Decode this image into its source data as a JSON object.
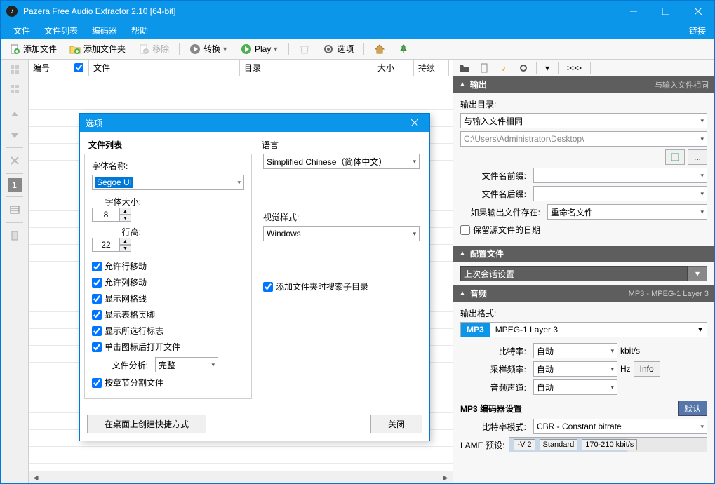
{
  "title_bar": {
    "title": "Pazera Free Audio Extractor 2.10  [64-bit]"
  },
  "menu": {
    "file": "文件",
    "filelist": "文件列表",
    "encoder": "编码器",
    "help": "帮助",
    "link": "链接"
  },
  "toolbar": {
    "add_file": "添加文件",
    "add_folder": "添加文件夹",
    "remove": "移除",
    "convert": "转换",
    "play": "Play",
    "options": "选项"
  },
  "columns": {
    "num": "编号",
    "file": "文件",
    "dir": "目录",
    "size": "大小",
    "dur": "持续"
  },
  "right": {
    "output_header": "输出",
    "output_sub": "与输入文件相同",
    "output_dir_label": "输出目录:",
    "output_dir_same": "与输入文件相同",
    "output_path": "C:\\Users\\Administrator\\Desktop\\",
    "prefix_label": "文件名前缀:",
    "suffix_label": "文件名后缀:",
    "exists_label": "如果输出文件存在:",
    "exists_value": "重命名文件",
    "preserve_date": "保留源文件的日期",
    "config_header": "配置文件",
    "config_value": "上次会话设置",
    "audio_header": "音频",
    "audio_sub": "MP3 - MPEG-1 Layer 3",
    "output_format_label": "输出格式:",
    "format_code": "MP3",
    "format_name": "MPEG-1 Layer 3",
    "bitrate_label": "比特率:",
    "bitrate_value": "自动",
    "bitrate_unit": "kbit/s",
    "samplerate_label": "采样频率:",
    "samplerate_value": "自动",
    "samplerate_unit": "Hz",
    "info_btn": "Info",
    "channels_label": "音频声道:",
    "channels_value": "自动",
    "mp3_encoder_label": "MP3 编码器设置",
    "bitrate_mode_label": "比特率模式:",
    "bitrate_mode_value": "CBR - Constant bitrate",
    "lame_label": "LAME 预设:",
    "lame_v": "-V 2",
    "lame_std": "Standard",
    "lame_range": "170-210 kbit/s",
    "default_btn": "默认"
  },
  "right_tabs_more": ">>>",
  "dialog": {
    "title": "选项",
    "filelist_header": "文件列表",
    "fontname_label": "字体名称:",
    "fontname_value": "Segoe UI",
    "fontsize_label": "字体大小:",
    "fontsize_value": "8",
    "rowheight_label": "行高:",
    "rowheight_value": "22",
    "chk_rowmove": "允许行移动",
    "chk_colmove": "允许列移动",
    "chk_gridlines": "显示网格线",
    "chk_footer": "显示表格页脚",
    "chk_selmark": "显示所选行标志",
    "chk_openicon": "单击图标后打开文件",
    "fileanalysis_label": "文件分析:",
    "fileanalysis_value": "完整",
    "chk_chapter": "按章节分割文件",
    "lang_label": "语言",
    "lang_value": "Simplified Chinese（简体中文）",
    "style_label": "视觉样式:",
    "style_value": "Windows",
    "chk_subdir": "添加文件夹时搜索子目录",
    "btn_shortcut": "在桌面上创建快捷方式",
    "btn_close": "关闭"
  }
}
